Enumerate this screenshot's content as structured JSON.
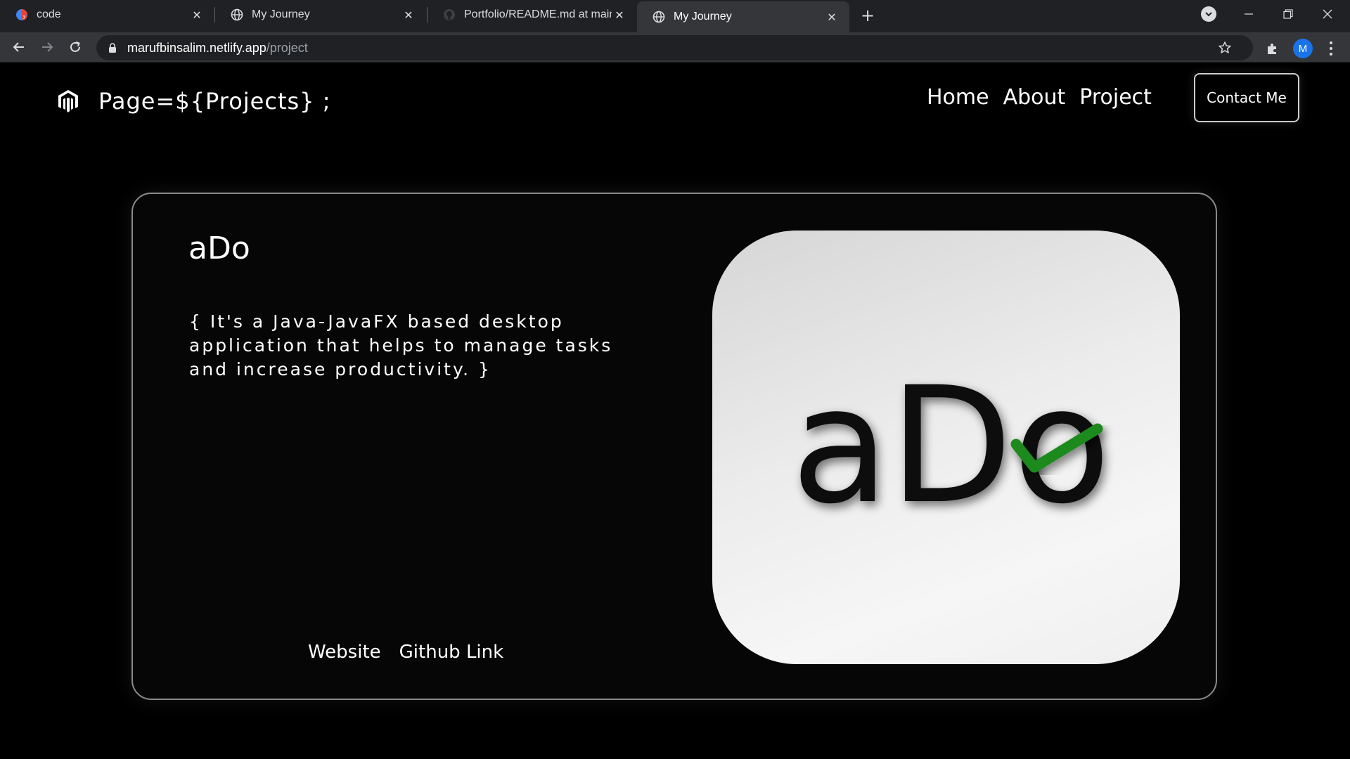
{
  "browser": {
    "tabs": [
      {
        "title": "code",
        "icon": "drive-icon"
      },
      {
        "title": "My Journey",
        "icon": "globe-icon"
      },
      {
        "title": "Portfolio/README.md at main · n",
        "icon": "github-icon"
      },
      {
        "title": "My Journey",
        "icon": "globe-icon",
        "active": true
      }
    ],
    "address": {
      "host": "marufbinsalim.netlify.app",
      "path": "/project"
    },
    "profile_initial": "M"
  },
  "site": {
    "brand": "Page=${Projects} ;",
    "nav": {
      "home": "Home",
      "about": "About",
      "project": "Project"
    },
    "contact_label": "Contact Me"
  },
  "project": {
    "title": "aDo",
    "description": "{ It's a Java-JavaFX based desktop application that helps to manage tasks and increase productivity. }",
    "links": {
      "website": "Website",
      "github": "Github Link"
    },
    "logo_text": "aDo",
    "logo_check_color": "#1f8a1f"
  }
}
